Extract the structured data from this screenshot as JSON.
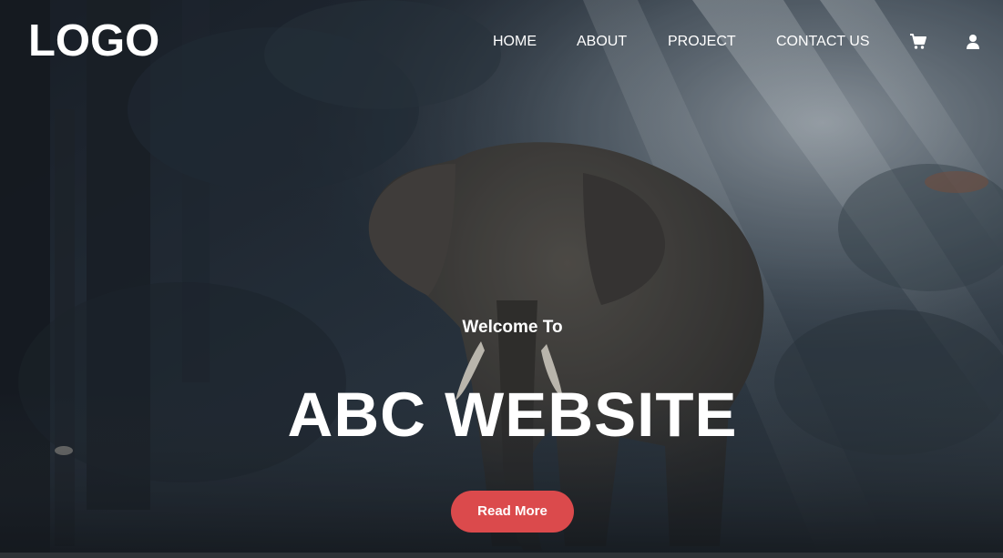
{
  "header": {
    "logo": "LOGO",
    "nav": [
      {
        "label": "HOME"
      },
      {
        "label": "ABOUT"
      },
      {
        "label": "PROJECT"
      },
      {
        "label": "CONTACT US"
      }
    ],
    "icons": [
      "cart-icon",
      "user-icon"
    ]
  },
  "hero": {
    "welcome": "Welcome To",
    "headline": "ABC WEBSITE",
    "button_label": "Read More",
    "background": "forest-elephant-photo"
  },
  "colors": {
    "text": "#ffffff",
    "button": "#db4a4c",
    "overlay": "#1c2530"
  }
}
